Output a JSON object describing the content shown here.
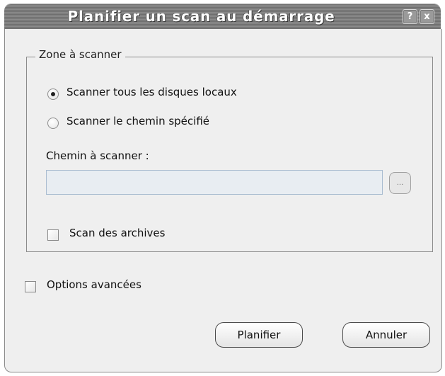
{
  "window": {
    "title": "Planifier un scan au démarrage",
    "help_glyph": "?",
    "close_glyph": "x"
  },
  "group": {
    "legend": "Zone à scanner",
    "radio_all": "Scanner tous les disques locaux",
    "radio_all_selected": true,
    "radio_path": "Scanner le chemin spécifié",
    "radio_path_selected": false,
    "path_label": "Chemin à scanner :",
    "path_value": "",
    "browse_label": "...",
    "archives_label": "Scan des archives",
    "archives_checked": false
  },
  "advanced": {
    "label": "Options avancées",
    "checked": false
  },
  "buttons": {
    "plan": "Planifier",
    "cancel": "Annuler"
  }
}
